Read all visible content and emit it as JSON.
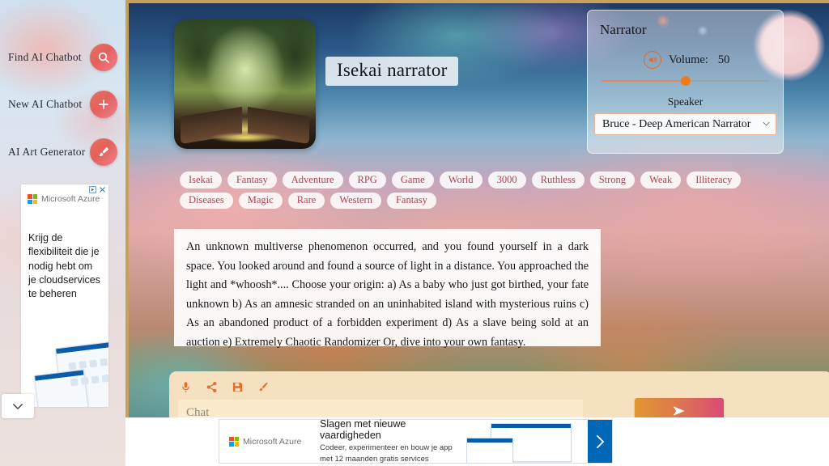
{
  "sidebar": {
    "items": [
      {
        "label": "Find AI Chatbot",
        "icon": "search-icon"
      },
      {
        "label": "New AI Chatbot",
        "icon": "plus-icon"
      },
      {
        "label": "AI Art Generator",
        "icon": "brush-icon"
      }
    ]
  },
  "left_ad": {
    "brand": "Microsoft Azure",
    "headline": "Krijg de flexibiliteit die je nodig hebt om je cloudservices te beheren",
    "close_label": "×"
  },
  "bottom_ad": {
    "brand": "Microsoft Azure",
    "headline": "Slagen met nieuwe vaardigheden",
    "subtext": "Codeer, experimenteer en bouw je app met 12 maanden gratis services",
    "close_label": "×"
  },
  "character": {
    "title": "Isekai narrator",
    "avatar_alt": "magical-forest-open-book",
    "tags": [
      "Isekai",
      "Fantasy",
      "Adventure",
      "RPG",
      "Game",
      "World",
      "3000",
      "Ruthless",
      "Strong",
      "Weak",
      "Illiteracy",
      "Diseases",
      "Magic",
      "Rare",
      "Western",
      "Fantasy"
    ]
  },
  "story": {
    "text": "An unknown multiverse phenomenon occurred, and you found yourself in a dark space. You looked around and found a source of light in a distance. You approached the light and *whoosh*.... Choose your origin: a) As a baby who just got birthed, your fate unknown b) As an amnesic stranded on an uninhabited island with mysterious ruins c) As an abandoned product of a forbidden experiment d) As a slave being sold at an auction e) Extremely Chaotic Randomizer Or, dive into your own fantasy."
  },
  "narrator": {
    "title": "Narrator",
    "volume_label": "Volume:",
    "volume_value": "50",
    "volume_percent": 50,
    "speaker_label": "Speaker",
    "speaker_selected": "Bruce - Deep American Narrator"
  },
  "chat": {
    "placeholder": "Chat",
    "value": "",
    "tools": [
      "microphone-icon",
      "share-icon",
      "save-icon",
      "brush-icon"
    ],
    "send_label": "send-icon"
  },
  "colors": {
    "accent_orange": "#ef7b1f",
    "accent_red": "#e4615c",
    "tag_text": "#b0424e",
    "send_gradient_start": "#e0972f",
    "send_gradient_end": "#da4a77",
    "panel_border_gold": "#c8a05c",
    "ad_blue": "#0067b8"
  }
}
